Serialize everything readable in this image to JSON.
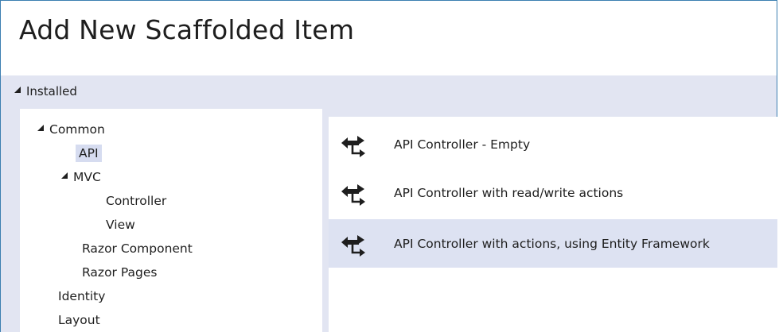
{
  "dialog": {
    "title": "Add New Scaffolded Item",
    "installed_label": "Installed"
  },
  "tree": {
    "common": "Common",
    "api": "API",
    "mvc": "MVC",
    "controller": "Controller",
    "view": "View",
    "razor_component": "Razor Component",
    "razor_pages": "Razor Pages",
    "identity": "Identity",
    "layout": "Layout"
  },
  "templates": [
    {
      "label": "API Controller - Empty",
      "icon": "api-controller-icon"
    },
    {
      "label": "API Controller with read/write actions",
      "icon": "api-controller-icon"
    },
    {
      "label": "API Controller with actions, using Entity Framework",
      "icon": "api-controller-icon",
      "selected": true
    }
  ],
  "colors": {
    "accent_border": "#3c7fb1",
    "panel_bg": "#e2e5f2",
    "selection": "#dde2f2"
  }
}
